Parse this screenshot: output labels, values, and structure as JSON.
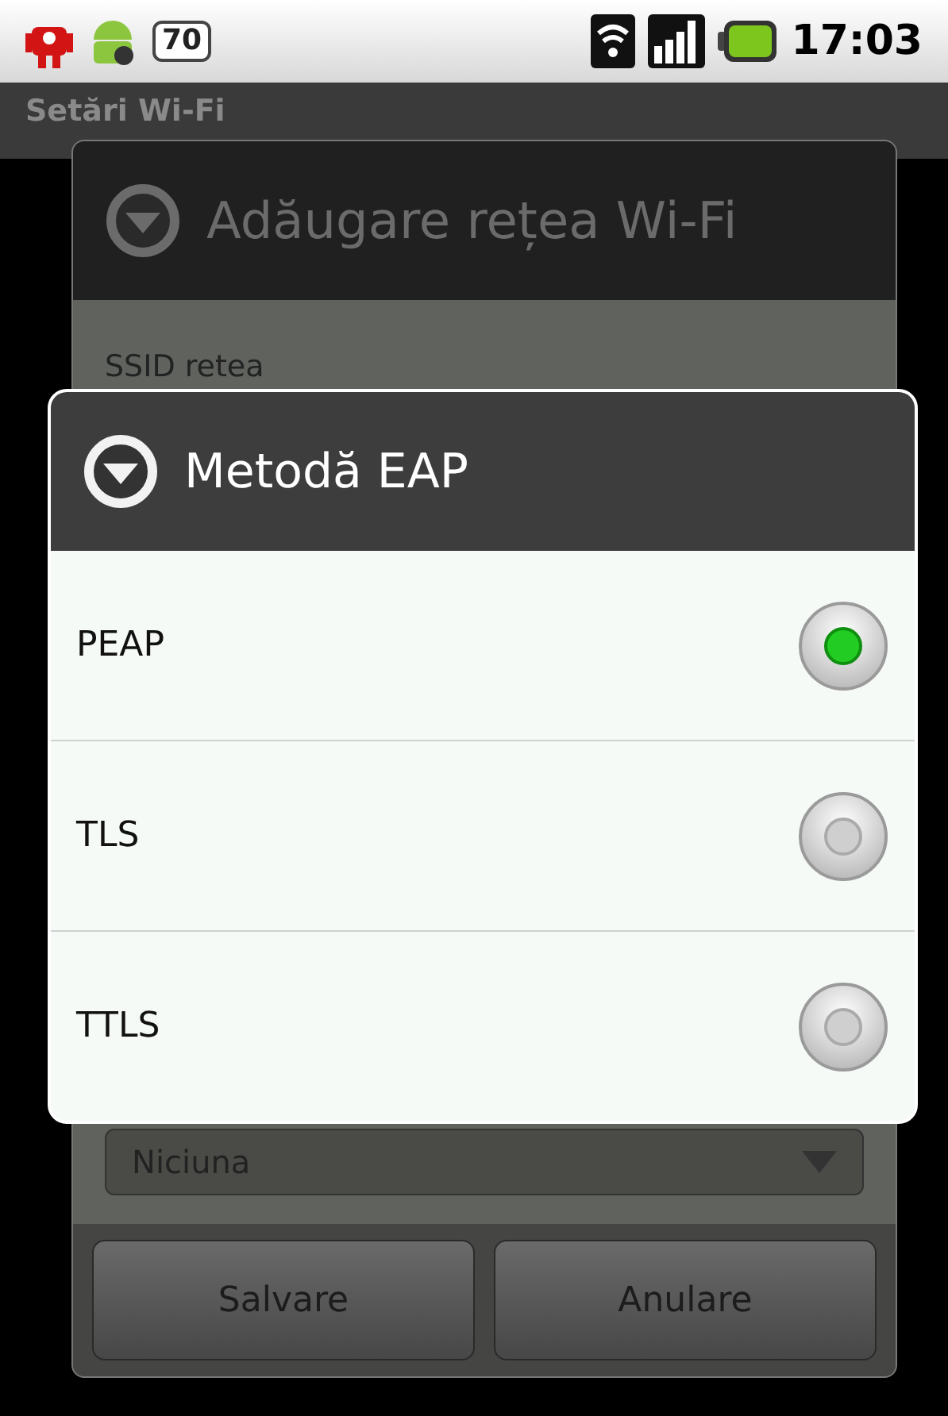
{
  "status_bar": {
    "battery_badge": "70",
    "time": "17:03"
  },
  "screen": {
    "title": "Setări Wi-Fi"
  },
  "dialog": {
    "title": "Adăugare rețea Wi-Fi",
    "ssid_label": "SSID retea",
    "security_value": "Niciuna",
    "buttons": [
      "Salvare",
      "Anulare"
    ]
  },
  "popup": {
    "title": "Metodă EAP",
    "options": [
      {
        "label": "PEAP",
        "selected": true
      },
      {
        "label": "TLS",
        "selected": false
      },
      {
        "label": "TTLS",
        "selected": false
      }
    ]
  }
}
